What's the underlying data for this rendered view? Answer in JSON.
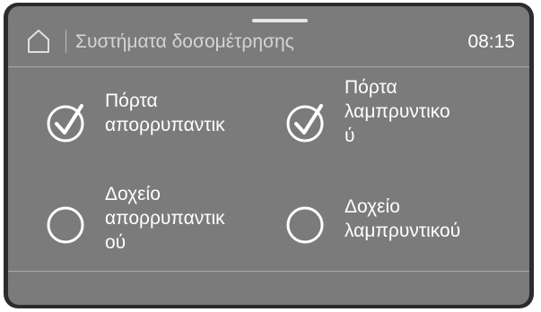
{
  "header": {
    "title": "Συστήματα δοσομέτρησης",
    "time": "08:15",
    "home_icon": "home-icon"
  },
  "items": [
    {
      "label": "Πόρτα\nαπορρυπαντικ",
      "status": "checked",
      "icon": "check-circle-icon"
    },
    {
      "label": "Πόρτα\nλαμπρυντικο\nύ",
      "status": "checked",
      "icon": "check-circle-icon"
    },
    {
      "label": "Δοχείο\nαπορρυπαντικ\nού",
      "status": "unchecked",
      "icon": "empty-circle-icon"
    },
    {
      "label": "Δοχείο\nλαμπρυντικού",
      "status": "unchecked",
      "icon": "empty-circle-icon"
    }
  ],
  "colors": {
    "screen_background": "#7b7b7b",
    "frame": "#2b2b2b",
    "text": "#ffffff"
  }
}
